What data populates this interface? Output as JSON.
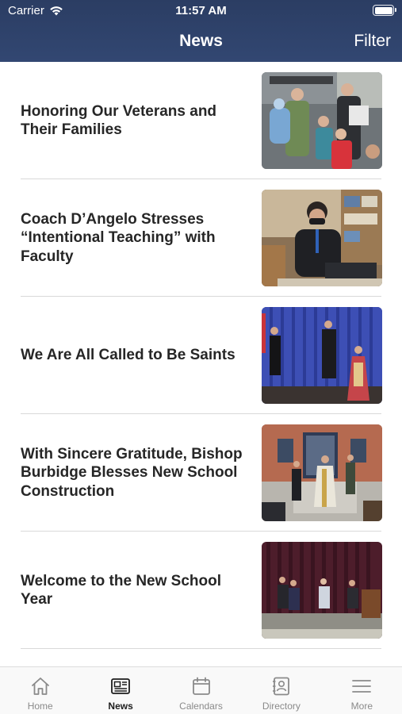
{
  "status_bar": {
    "carrier": "Carrier",
    "time": "11:57 AM",
    "battery_level": 1.0
  },
  "nav": {
    "title": "News",
    "filter_label": "Filter"
  },
  "news": [
    {
      "title": "Honoring Our Veterans and Their Families",
      "thumb": "veterans-photo"
    },
    {
      "title": "Coach D’Angelo Stresses “Intentional Teaching” with Faculty",
      "thumb": "teaching-photo"
    },
    {
      "title": "We Are All Called to Be Saints",
      "thumb": "saints-stage-photo"
    },
    {
      "title": "With Sincere Gratitude, Bishop Burbidge Blesses New School Construction",
      "thumb": "bishop-blessing-photo"
    },
    {
      "title": "Welcome to the New School Year",
      "thumb": "school-year-stage-photo"
    }
  ],
  "tabs": [
    {
      "label": "Home",
      "icon": "home-icon",
      "active": false
    },
    {
      "label": "News",
      "icon": "newspaper-icon",
      "active": true
    },
    {
      "label": "Calendars",
      "icon": "calendar-icon",
      "active": false
    },
    {
      "label": "Directory",
      "icon": "contacts-icon",
      "active": false
    },
    {
      "label": "More",
      "icon": "menu-icon",
      "active": false
    }
  ],
  "colors": {
    "header_bg": "#2b3d63",
    "active_tab": "#1d1d1d",
    "inactive_tab": "#8a8a8a"
  }
}
